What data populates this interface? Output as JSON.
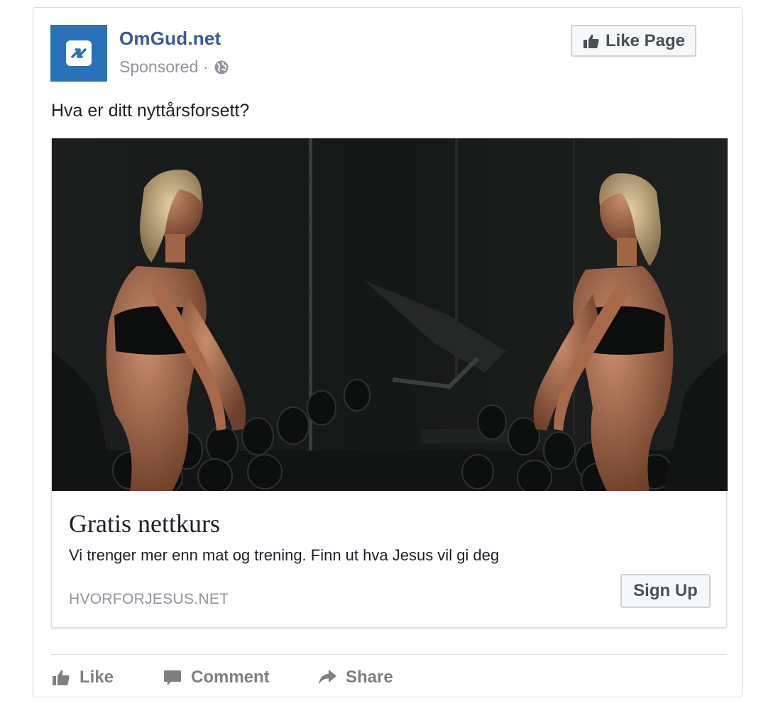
{
  "post": {
    "page_name": "OmGud.net",
    "sponsored_label": "Sponsored",
    "separator": "·",
    "audience_icon": "globe-icon",
    "avatar_icon": "refresh-arrows-icon",
    "like_page_label": "Like Page",
    "text": "Hva er ditt nyttårsforsett?"
  },
  "link": {
    "image_description_icon": "gym-photo",
    "headline": "Gratis nettkurs",
    "description": "Vi trenger mer enn mat og trening. Finn ut hva Jesus vil gi deg",
    "domain": "HVORFORJESUS.NET",
    "cta_label": "Sign Up"
  },
  "actions": [
    {
      "label": "Like",
      "icon": "thumbs-up-icon"
    },
    {
      "label": "Comment",
      "icon": "comment-icon"
    },
    {
      "label": "Share",
      "icon": "share-icon"
    }
  ],
  "colors": {
    "brand_blue": "#3b5998",
    "avatar_bg": "#2a72b8",
    "muted_text": "#90949c"
  }
}
